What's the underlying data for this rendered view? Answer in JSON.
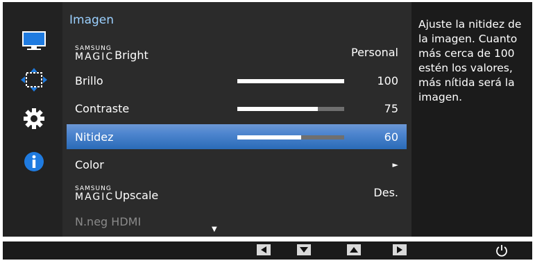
{
  "sidebar": {
    "icons": [
      "monitor-picture-icon",
      "position-arrows-icon",
      "gear-icon",
      "info-icon"
    ]
  },
  "menu": {
    "title": "Imagen",
    "items": [
      {
        "brand_top": "SAMSUNG",
        "brand_bottom": "MAGIC",
        "label": "Bright",
        "value": "Personal"
      },
      {
        "label": "Brillo",
        "value": "100",
        "level": 1.0
      },
      {
        "label": "Contraste",
        "value": "75",
        "level": 0.75
      },
      {
        "label": "Nitidez",
        "value": "60",
        "level": 0.6,
        "selected": true
      },
      {
        "label": "Color",
        "value": "►"
      },
      {
        "brand_top": "SAMSUNG",
        "brand_bottom": "MAGIC",
        "label": "Upscale",
        "value": "Des."
      },
      {
        "label": "N.neg HDMI",
        "disabled": true
      }
    ],
    "scroll_indicator": "▼"
  },
  "help": {
    "text": "Ajuste la nitidez de la imagen. Cuanto más cerca de 100 estén los valores, más nítida será la imagen."
  },
  "bottom_bar": {
    "keys": [
      "left-arrow-icon",
      "down-arrow-icon",
      "up-arrow-icon",
      "right-arrow-icon"
    ],
    "power_icon": "power-icon"
  },
  "colors": {
    "title": "#9bd0ff",
    "selected": "#2a6bb8",
    "bar_fill": "#ffffff",
    "bar_track": "#6f6f6f"
  }
}
